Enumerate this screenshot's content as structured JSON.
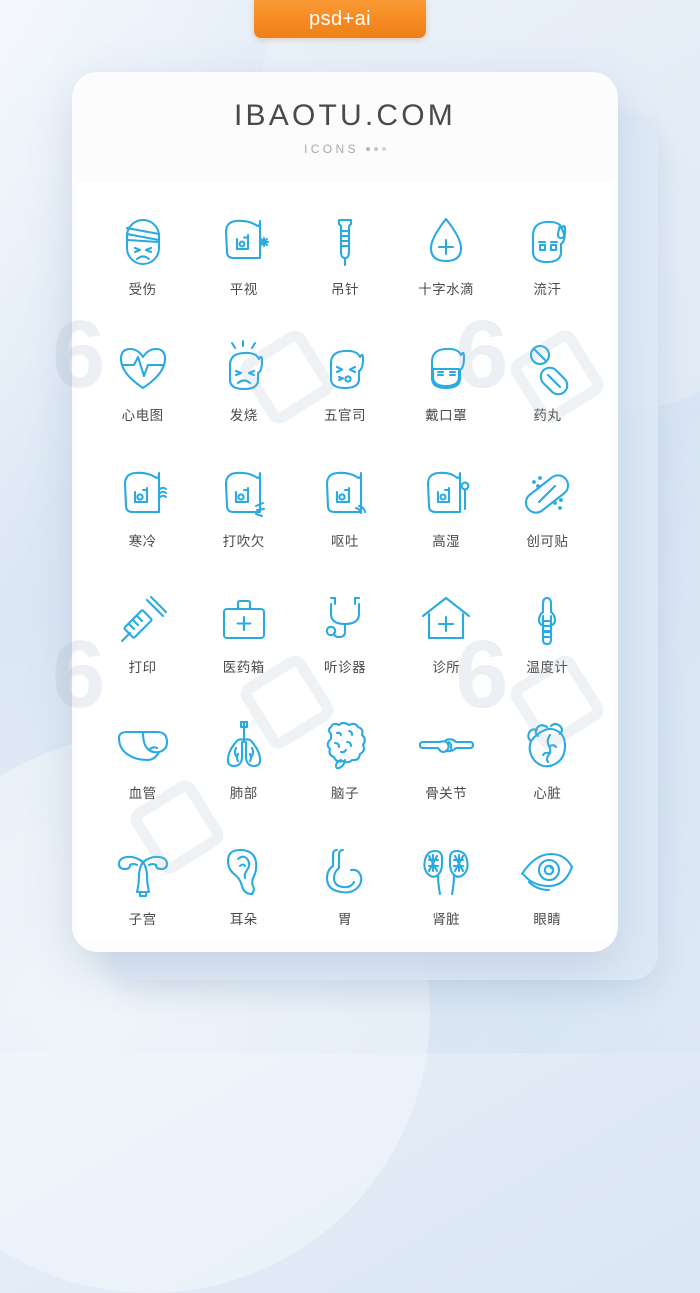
{
  "badge": {
    "label": "psd+ai"
  },
  "header": {
    "brand": "IBAOTU.COM",
    "subtitle": "ICONS"
  },
  "colors": {
    "icon_stroke": "#29abe2",
    "label_text": "#4b4b4b",
    "brand_text": "#4a4a4a",
    "subtitle_text": "#a9a9a9",
    "badge_orange": "#f58a21",
    "card_background": "#fdfdfe",
    "page_background": "#d9e5f3"
  },
  "icons": [
    {
      "label": "受伤",
      "name": "bandaged-head-icon"
    },
    {
      "label": "平视",
      "name": "side-profile-face-icon"
    },
    {
      "label": "吊针",
      "name": "iv-drip-icon"
    },
    {
      "label": "十字水滴",
      "name": "cross-water-drop-icon"
    },
    {
      "label": "流汗",
      "name": "sweating-face-icon"
    },
    {
      "label": "心电图",
      "name": "heart-ecg-icon"
    },
    {
      "label": "发烧",
      "name": "fever-face-icon"
    },
    {
      "label": "五官司",
      "name": "facial-features-icon"
    },
    {
      "label": "戴口罩",
      "name": "face-mask-icon"
    },
    {
      "label": "药丸",
      "name": "pills-icon"
    },
    {
      "label": "寒冷",
      "name": "cold-profile-icon"
    },
    {
      "label": "打吹欠",
      "name": "yawn-profile-icon"
    },
    {
      "label": "呕吐",
      "name": "vomit-profile-icon"
    },
    {
      "label": "高湿",
      "name": "humidity-profile-icon"
    },
    {
      "label": "创可贴",
      "name": "bandage-plaster-icon"
    },
    {
      "label": "打印",
      "name": "syringe-icon"
    },
    {
      "label": "医药箱",
      "name": "medical-kit-icon"
    },
    {
      "label": "听诊器",
      "name": "stethoscope-icon"
    },
    {
      "label": "诊所",
      "name": "clinic-house-icon"
    },
    {
      "label": "温度计",
      "name": "thermometer-icon"
    },
    {
      "label": "血管",
      "name": "liver-icon"
    },
    {
      "label": "肺部",
      "name": "lungs-icon"
    },
    {
      "label": "脑子",
      "name": "brain-icon"
    },
    {
      "label": "骨关节",
      "name": "bone-joint-icon"
    },
    {
      "label": "心脏",
      "name": "heart-organ-icon"
    },
    {
      "label": "子宫",
      "name": "uterus-icon"
    },
    {
      "label": "耳朵",
      "name": "ear-icon"
    },
    {
      "label": "胃",
      "name": "stomach-icon"
    },
    {
      "label": "肾脏",
      "name": "kidneys-icon"
    },
    {
      "label": "眼睛",
      "name": "eye-icon"
    }
  ]
}
